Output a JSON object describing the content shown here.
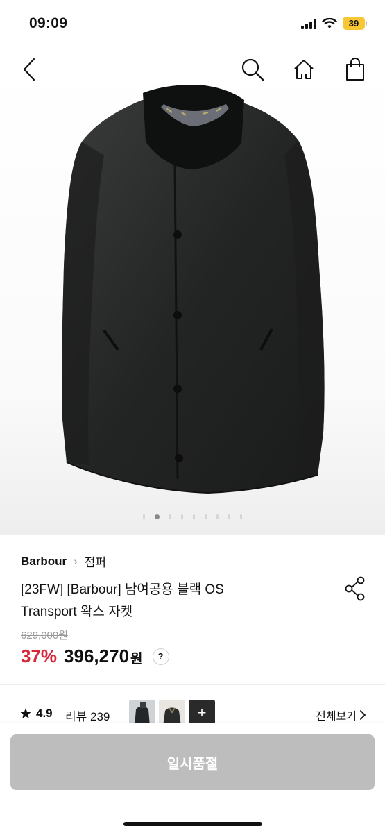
{
  "status_bar": {
    "time": "09:09",
    "battery": "39"
  },
  "product": {
    "brand": "Barbour",
    "category": "점퍼",
    "title_line1": "[23FW] [Barbour] 남여공용 블랙 OS",
    "title_line2": "Transport 왁스 자켓",
    "original_price": "629,000원",
    "discount": "37%",
    "price": "396,270",
    "currency": "원",
    "help": "?",
    "image_index": 2,
    "image_count": 9
  },
  "reviews": {
    "rating": "4.9",
    "review_label": "리뷰 239",
    "more_symbol": "+",
    "see_all": "전체보기"
  },
  "bottom": {
    "button_label": "일시품절"
  },
  "colors": {
    "discount": "#d6263a",
    "sold_out_button": "#bdbdbd",
    "battery": "#f7c833"
  }
}
